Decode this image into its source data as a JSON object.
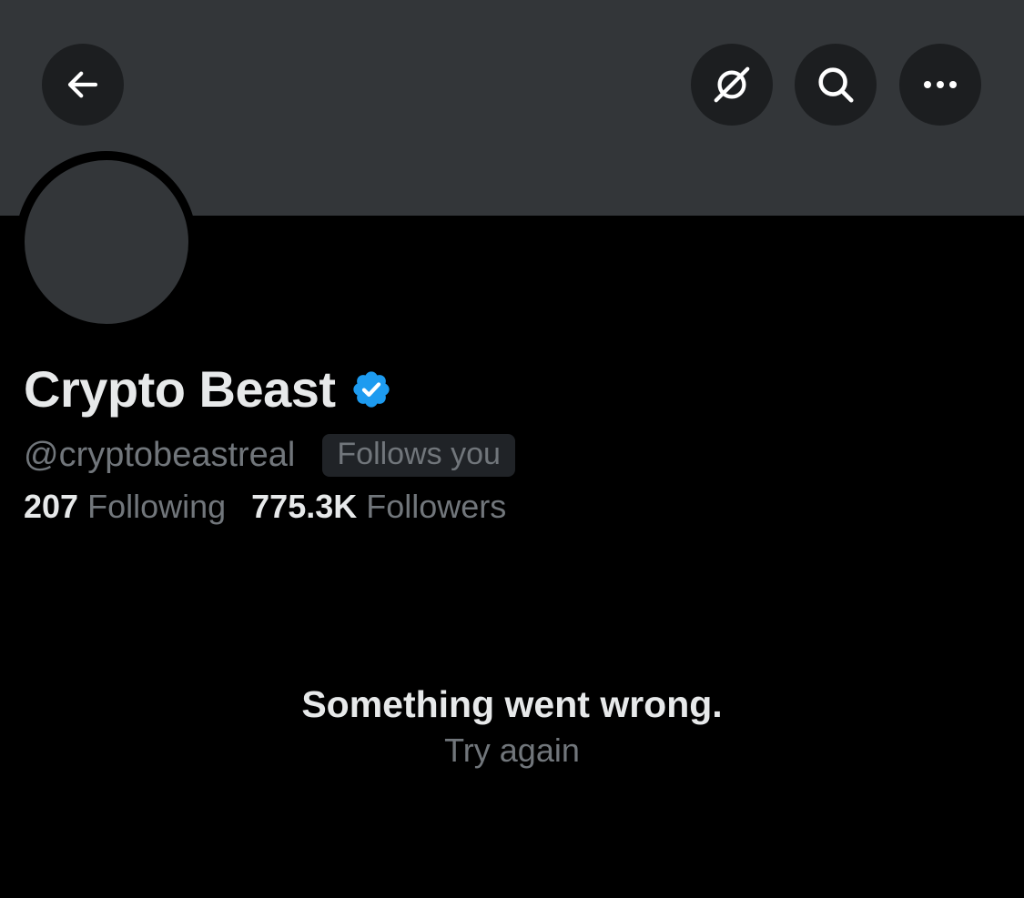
{
  "header": {
    "back_icon": "arrow-left-icon",
    "grok_icon": "grok-icon",
    "search_icon": "search-icon",
    "more_icon": "more-dots-icon"
  },
  "profile": {
    "display_name": "Crypto Beast",
    "verified": true,
    "verified_color": "#1d9bf0",
    "handle": "@cryptobeastreal",
    "follows_you_label": "Follows you",
    "following_count": "207",
    "following_label": "Following",
    "followers_count": "775.3K",
    "followers_label": "Followers"
  },
  "error": {
    "title": "Something went wrong.",
    "retry_label": "Try again"
  },
  "colors": {
    "background": "#000000",
    "banner": "#333639",
    "text_primary": "#e7e9ea",
    "text_secondary": "#71767b"
  }
}
